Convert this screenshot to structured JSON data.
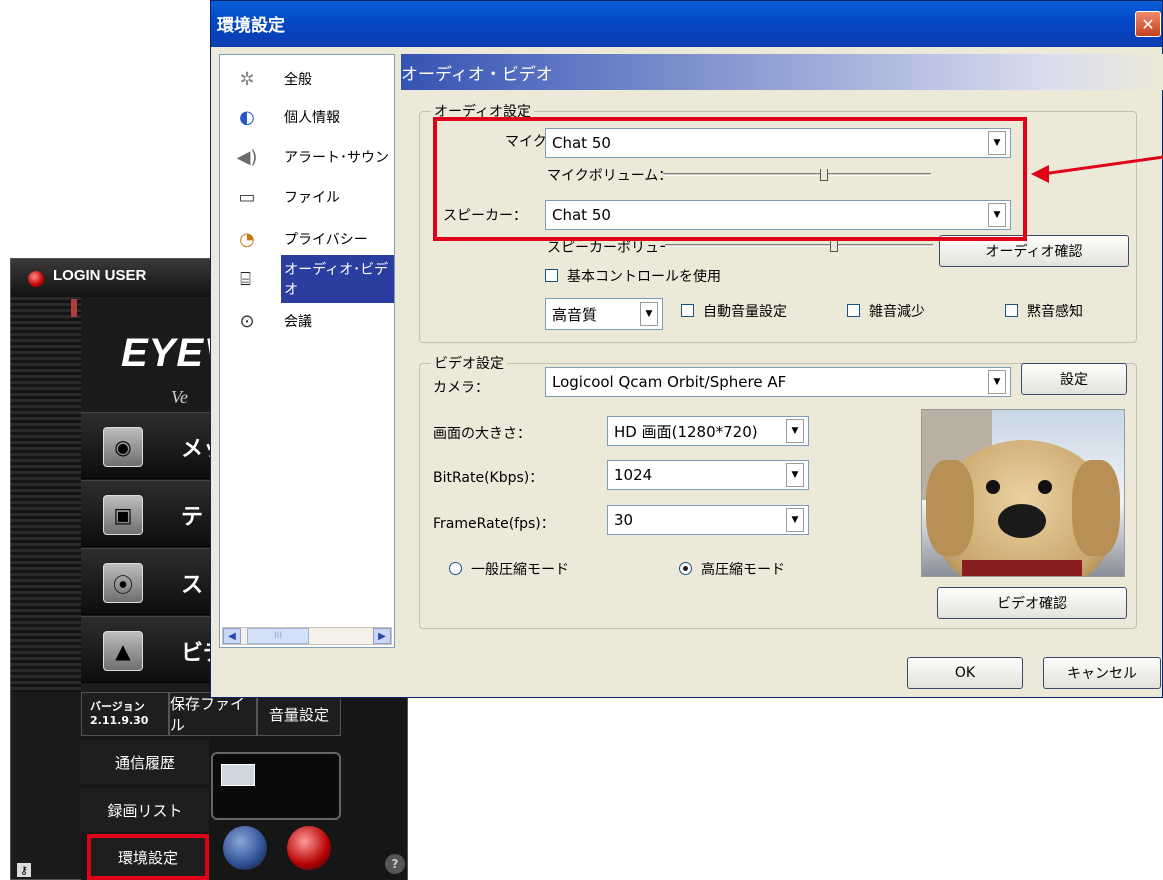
{
  "app": {
    "login_label": "LOGIN USER",
    "logo": "EYEV",
    "logo_sub": "Ve",
    "buttons": [
      "メッ",
      "テ",
      "ス",
      "ビデ"
    ],
    "version_label": "バージョン",
    "version_value": "2.11.9.30",
    "saved_files": "保存ファイル",
    "volume_settings": "音量設定",
    "comm_history": "通信履歴",
    "recording_list": "録画リスト",
    "settings": "環境設定",
    "help_glyph": "?"
  },
  "dialog": {
    "title": "環境設定",
    "nav": [
      {
        "label": "全般",
        "icon": "gears-icon"
      },
      {
        "label": "個人情報",
        "icon": "person-icon"
      },
      {
        "label": "アラート･サウン",
        "icon": "speaker-icon"
      },
      {
        "label": "ファイル",
        "icon": "folder-icon"
      },
      {
        "label": "プライバシー",
        "icon": "lock-icon"
      },
      {
        "label": "オーディオ･ビデオ",
        "icon": "av-icon"
      },
      {
        "label": "会議",
        "icon": "meeting-icon"
      }
    ],
    "panel_title": "オーディオ・ビデオ",
    "audio": {
      "group_label": "オーディオ設定",
      "mic_label": "マイク：",
      "mic_value": "Chat 50",
      "mic_volume_label": "マイクボリューム：",
      "mic_volume_level": 0.6,
      "speaker_label": "スピーカー：",
      "speaker_value": "Chat 50",
      "speaker_volume_label": "スピーカーボリュー",
      "speaker_volume_level": 0.63,
      "audio_check_button": "オーディオ確認",
      "basic_control_label": "基本コントロールを使用",
      "quality_value": "高音質",
      "auto_volume_label": "自動音量設定",
      "noise_reduction_label": "雑音減少",
      "silence_detect_label": "黙音感知"
    },
    "video": {
      "group_label": "ビデオ設定",
      "camera_label": "カメラ：",
      "camera_value": "Logicool Qcam Orbit/Sphere AF",
      "settings_button": "設定",
      "screen_size_label": "画面の大きさ：",
      "screen_size_value": "HD 画面(1280*720)",
      "bitrate_label": "BitRate(Kbps)：",
      "bitrate_value": "1024",
      "framerate_label": "FrameRate(fps)：",
      "framerate_value": "30",
      "normal_mode_label": "一般圧縮モード",
      "high_mode_label": "高圧縮モード",
      "video_check_button": "ビデオ確認"
    },
    "ok_button": "OK",
    "cancel_button": "キャンセル"
  },
  "colors": {
    "highlight": "#e0001a",
    "title_bar": "#0349c9",
    "nav_active": "#2a3ea0"
  }
}
